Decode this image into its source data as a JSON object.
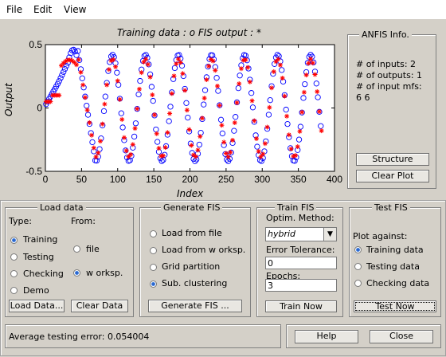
{
  "menu": {
    "file": "File",
    "edit": "Edit",
    "view": "View"
  },
  "plot": {
    "title": "Training data : o   FIS output : *",
    "ylabel": "Output",
    "xlabel": "Index",
    "xticks": [
      "0",
      "50",
      "100",
      "150",
      "200",
      "250",
      "300",
      "350",
      "400"
    ],
    "yticks": [
      "0.5",
      "0",
      "-0.5"
    ]
  },
  "chart_data": {
    "type": "scatter",
    "title": "Training data : o   FIS output : *",
    "xlabel": "Index",
    "ylabel": "Output",
    "xlim": [
      0,
      400
    ],
    "ylim": [
      -0.5,
      0.5
    ],
    "grid": false,
    "series": [
      {
        "name": "Training data",
        "marker": "o",
        "color": "#0000ff",
        "x_range": [
          1,
          382
        ],
        "model": "approx. sinusoid, amplitude ~0.4, rising to ~0.45 near x=40, min ~-0.45 near x=70, ~11 cycles"
      },
      {
        "name": "FIS output",
        "marker": "*",
        "color": "#ff0000",
        "x_range": [
          1,
          382
        ],
        "model": "closely follows training data; plateau ~0.1 for x<20, ~0.35 around x=20-45"
      }
    ]
  },
  "anfis": {
    "title": "ANFIS Info.",
    "inputs": "# of inputs: 2",
    "outputs": "# of outputs: 1",
    "mfs": "# of input mfs:",
    "mfs_val": "6  6",
    "structure_btn": "Structure",
    "clear_plot_btn": "Clear Plot"
  },
  "load": {
    "title": "Load data",
    "type_label": "Type:",
    "from_label": "From:",
    "types": [
      "Training",
      "Testing",
      "Checking",
      "Demo"
    ],
    "from": [
      "file",
      "w orksp."
    ],
    "load_btn": "Load Data...",
    "clear_btn": "Clear Data"
  },
  "gen": {
    "title": "Generate FIS",
    "options": [
      "Load from file",
      "Load from w orksp.",
      "Grid partition",
      "Sub. clustering"
    ],
    "btn": "Generate FIS ..."
  },
  "train": {
    "title": "Train FIS",
    "method_label": "Optim. Method:",
    "method_value": "hybrid",
    "tol_label": "Error Tolerance:",
    "tol_value": "0",
    "epochs_label": "Epochs:",
    "epochs_value": "3",
    "btn": "Train Now"
  },
  "test": {
    "title": "Test FIS",
    "plot_against": "Plot against:",
    "options": [
      "Training data",
      "Testing data",
      "Checking data"
    ],
    "btn": "Test Now"
  },
  "status": {
    "text": "Average testing error: 0.054004"
  },
  "footer": {
    "help": "Help",
    "close": "Close"
  }
}
